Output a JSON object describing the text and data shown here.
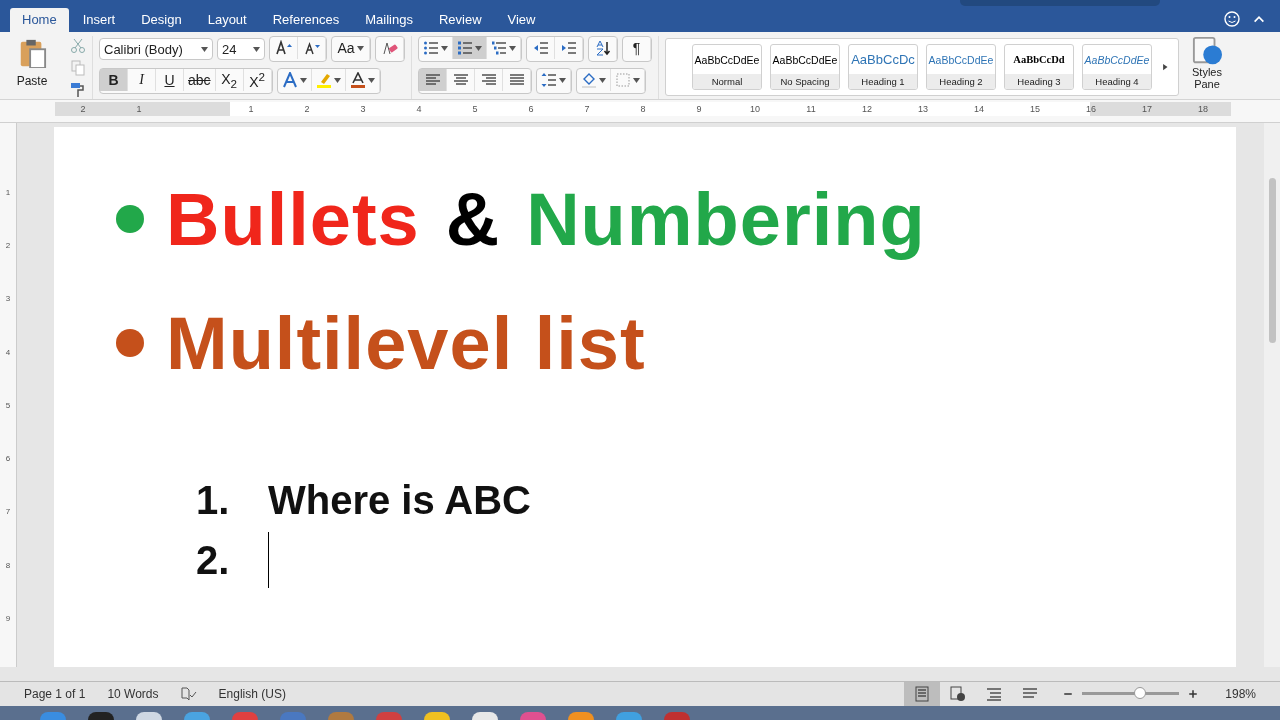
{
  "tabs": [
    {
      "label": "Home",
      "selected": true
    },
    {
      "label": "Insert",
      "selected": false
    },
    {
      "label": "Design",
      "selected": false
    },
    {
      "label": "Layout",
      "selected": false
    },
    {
      "label": "References",
      "selected": false
    },
    {
      "label": "Mailings",
      "selected": false
    },
    {
      "label": "Review",
      "selected": false
    },
    {
      "label": "View",
      "selected": false
    }
  ],
  "ribbon": {
    "paste": "Paste",
    "font_name": "Calibri (Body)",
    "font_size": "24",
    "change_case": "Aa",
    "format_buttons": [
      {
        "label": "B",
        "kind": "bold",
        "selected": true
      },
      {
        "label": "I",
        "kind": "italic",
        "selected": false
      },
      {
        "label": "U",
        "kind": "underline",
        "selected": false
      },
      {
        "label": "abc",
        "kind": "strike",
        "selected": false
      },
      {
        "label": "X$_{2}$",
        "kind": "sub",
        "selected": false
      },
      {
        "label": "X$^{2}$",
        "kind": "sup",
        "selected": false
      }
    ],
    "list_buttons": [
      {
        "kind": "bullets",
        "selected": false
      },
      {
        "kind": "numbering",
        "selected": true
      },
      {
        "kind": "multilevel",
        "selected": false
      }
    ],
    "show_marks": "¶",
    "align_buttons": [
      {
        "kind": "left",
        "selected": true
      },
      {
        "kind": "center",
        "selected": false
      },
      {
        "kind": "right",
        "selected": false
      },
      {
        "kind": "justify",
        "selected": false
      }
    ],
    "styles": [
      {
        "kind": "normal",
        "preview": "AaBbCcDdEe",
        "name": "Normal"
      },
      {
        "kind": "normal",
        "preview": "AaBbCcDdEe",
        "name": "No Spacing"
      },
      {
        "kind": "heading1",
        "preview": "AaBbCcDc",
        "name": "Heading 1"
      },
      {
        "kind": "heading2",
        "preview": "AaBbCcDdEe",
        "name": "Heading 2"
      },
      {
        "kind": "heading3",
        "preview": "AaBbCcDd",
        "name": "Heading 3"
      },
      {
        "kind": "heading4",
        "preview": "AaBbCcDdEe",
        "name": "Heading 4"
      }
    ],
    "styles_pane": "Styles Pane"
  },
  "ruler": {
    "left_labels": [
      "2",
      "1"
    ],
    "labels": [
      "1",
      "2",
      "3",
      "4",
      "5",
      "6",
      "7",
      "8",
      "9",
      "10",
      "11",
      "12",
      "13",
      "14",
      "15",
      "16",
      "17",
      "18"
    ],
    "vertical_labels": [
      "1",
      "2",
      "3",
      "4",
      "5",
      "6",
      "7",
      "8",
      "9"
    ]
  },
  "document": {
    "bullets": [
      {
        "color": "#22a84a",
        "segments": [
          {
            "text": "Bullets",
            "color": "#f0261b"
          },
          {
            "text": "&",
            "color": "#000000"
          },
          {
            "text": "Numbering",
            "color": "#22a84a"
          }
        ]
      },
      {
        "color": "#c5501b",
        "segments": [
          {
            "text": "Multilevel list",
            "color": "#c5501b"
          }
        ]
      }
    ],
    "numbered": [
      {
        "number": "1.",
        "text": "Where is ABC"
      },
      {
        "number": "2.",
        "cursor": true
      }
    ]
  },
  "status_bar": {
    "page": "Page 1 of 1",
    "words": "10 Words",
    "language": "English (US)",
    "views": [
      {
        "kind": "print",
        "selected": true
      },
      {
        "kind": "web",
        "selected": false
      },
      {
        "kind": "outline",
        "selected": false
      },
      {
        "kind": "draft",
        "selected": false
      }
    ],
    "zoom": {
      "level": 0.6,
      "reading": "198%"
    }
  }
}
